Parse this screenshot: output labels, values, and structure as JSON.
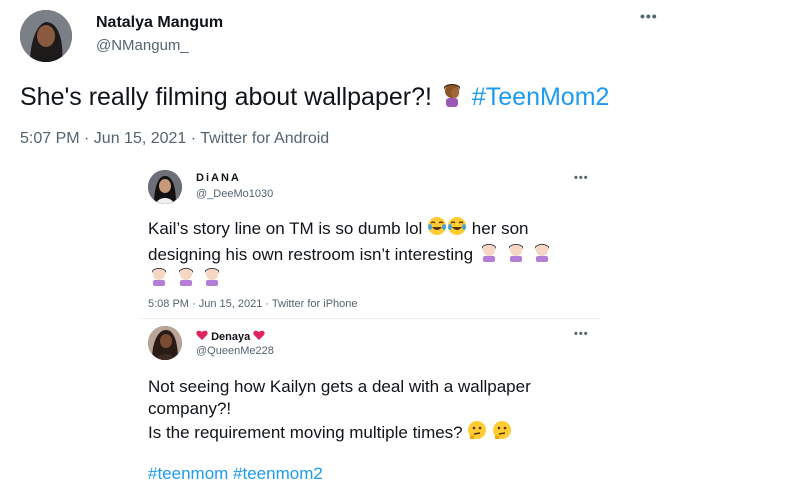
{
  "main_tweet": {
    "author_name": "Natalya Mangum",
    "author_handle": "@NMangum_",
    "more": "•••",
    "text": "She's really filming about wallpaper?!",
    "hashtag": "#TeenMom2",
    "meta": "5:07 PM · Jun 15, 2021 · Twitter for Android",
    "emoji_icon": "face-palm-icon"
  },
  "quote1": {
    "author_name": "DiANA",
    "author_handle": "@_DeeMo1030",
    "more": "•••",
    "line1": "Kail’s story line on TM is so dumb lol",
    "line1_after": "her son",
    "line2": "designing his own restroom isn’t interesting",
    "meta": "5:08 PM · Jun 15, 2021 · Twitter for iPhone",
    "emoji_laugh_icon": "tears-of-joy-icon",
    "emoji_face_palm_icon": "woman-facepalming-icon"
  },
  "quote2": {
    "author_name": "Denaya",
    "author_handle": "@QueenMe228",
    "more": "•••",
    "line1": "Not seeing how Kailyn gets a deal with a wallpaper",
    "line2": "company?!",
    "line3": "Is the requirement moving multiple times?",
    "hashtags": "#teenmom #teenmom2",
    "heart_icon": "heart-icon",
    "thinking_icon": "thinking-face-icon"
  },
  "colors": {
    "link": "#1d9bf0",
    "secondary_text": "#536471",
    "primary_text": "#0f1419"
  }
}
